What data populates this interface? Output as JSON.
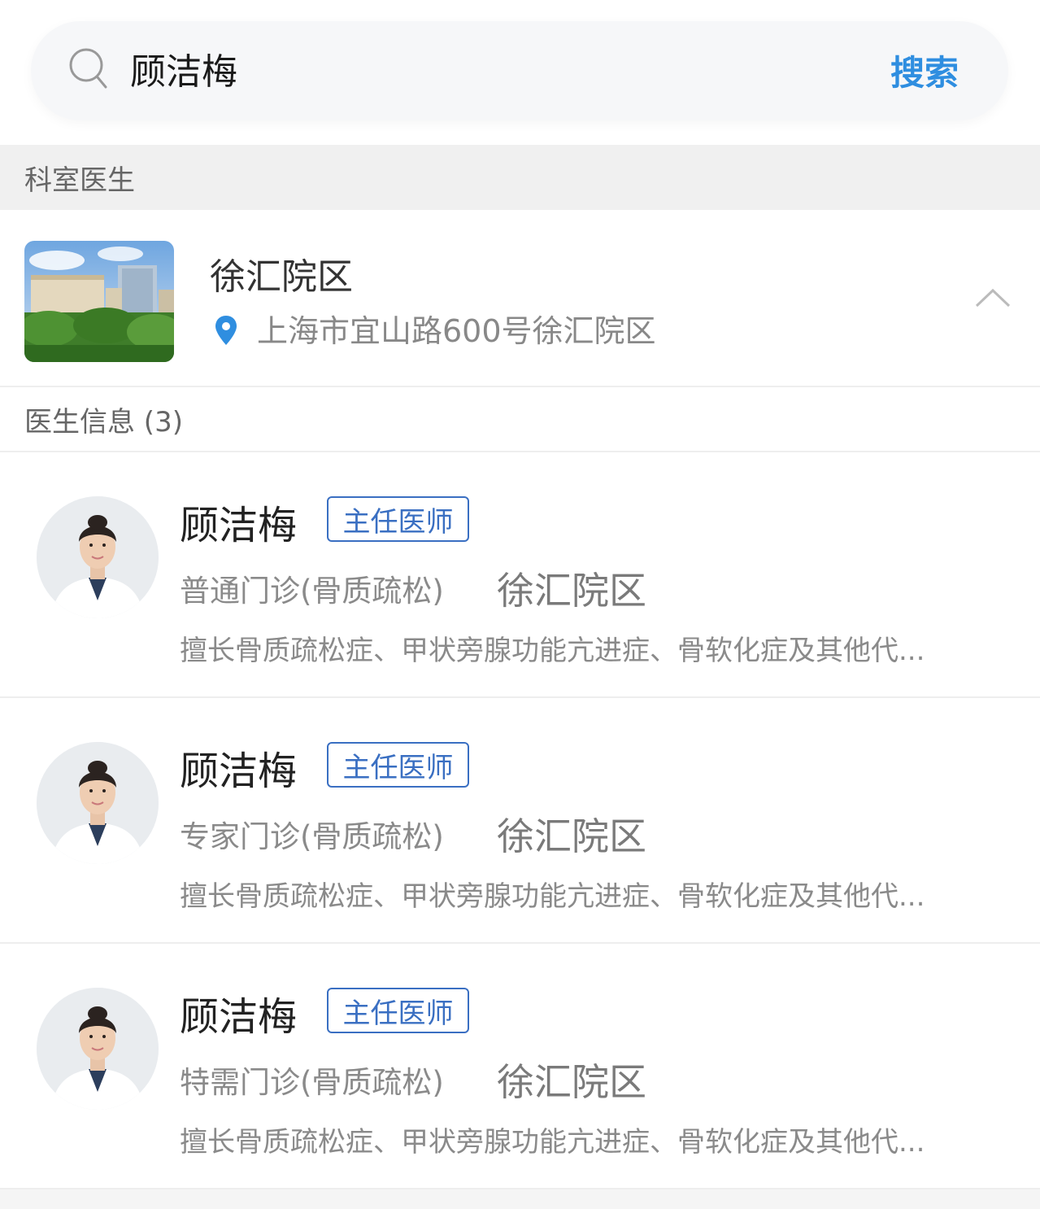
{
  "search": {
    "value": "顾洁梅",
    "button_label": "搜索",
    "icon": "search-icon"
  },
  "section": {
    "title": "科室医生"
  },
  "hospital": {
    "name": "徐汇院区",
    "address": "上海市宜山路600号徐汇院区",
    "pin_icon": "location-pin-icon",
    "collapse_icon": "chevron-up-icon"
  },
  "doctors_header": {
    "label": "医生信息 (3)"
  },
  "doctors": [
    {
      "name": "顾洁梅",
      "title": "主任医师",
      "clinic": "普通门诊(骨质疏松)",
      "campus": "徐汇院区",
      "specialty": "擅长骨质疏松症、甲状旁腺功能亢进症、骨软化症及其他代..."
    },
    {
      "name": "顾洁梅",
      "title": "主任医师",
      "clinic": "专家门诊(骨质疏松)",
      "campus": "徐汇院区",
      "specialty": "擅长骨质疏松症、甲状旁腺功能亢进症、骨软化症及其他代..."
    },
    {
      "name": "顾洁梅",
      "title": "主任医师",
      "clinic": "特需门诊(骨质疏松)",
      "campus": "徐汇院区",
      "specialty": "擅长骨质疏松症、甲状旁腺功能亢进症、骨软化症及其他代..."
    }
  ],
  "colors": {
    "accent": "#2f8ee0",
    "badge": "#3a6fc2",
    "pin": "#2f8ee0"
  }
}
